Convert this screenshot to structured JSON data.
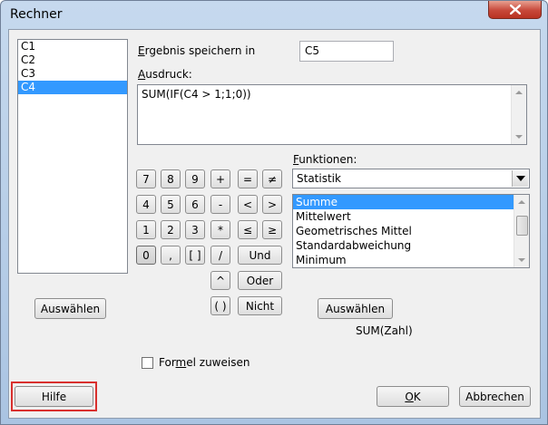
{
  "window": {
    "title": "Rechner"
  },
  "columns": [
    {
      "label": "C1",
      "selected": false
    },
    {
      "label": "C2",
      "selected": false
    },
    {
      "label": "C3",
      "selected": false
    },
    {
      "label": "C4",
      "selected": true
    }
  ],
  "store": {
    "label_u": "E",
    "label_rest": "rgebnis speichern in",
    "value": "C5"
  },
  "expression": {
    "label_u": "A",
    "label_rest": "usdruck:",
    "value": "SUM(IF(C4 > 1;1;0))"
  },
  "keypad": {
    "row1": [
      "7",
      "8",
      "9",
      "+",
      "=",
      "≠"
    ],
    "row2": [
      "4",
      "5",
      "6",
      "-",
      "<",
      ">"
    ],
    "row3": [
      "1",
      "2",
      "3",
      "*",
      "≤",
      "≥"
    ],
    "row4": [
      "0",
      ",",
      "[ ]",
      "/",
      "Und"
    ],
    "row5": [
      "^",
      "Oder"
    ],
    "row6": [
      "( )",
      "Nicht"
    ]
  },
  "functions": {
    "label_u": "F",
    "label_rest": "unktionen:",
    "category": "Statistik",
    "items": [
      {
        "label": "Summe",
        "selected": true
      },
      {
        "label": "Mittelwert",
        "selected": false
      },
      {
        "label": "Geometrisches Mittel",
        "selected": false
      },
      {
        "label": "Standardabweichung",
        "selected": false
      },
      {
        "label": "Minimum",
        "selected": false
      }
    ],
    "select_label": "Auswählen",
    "syntax": "SUM(Zahl)"
  },
  "left_select_label": "Auswählen",
  "assign_formula": {
    "pre": "For",
    "u": "m",
    "post": "el zuweisen",
    "checked": false
  },
  "footer": {
    "help": "Hilfe",
    "ok_u": "O",
    "ok_rest": "K",
    "cancel": "Abbrechen"
  },
  "colors": {
    "selection": "#3399ff",
    "highlight": "#d9302e"
  },
  "icons": {
    "close": "close-icon",
    "dropdown": "chevron-down-icon"
  }
}
